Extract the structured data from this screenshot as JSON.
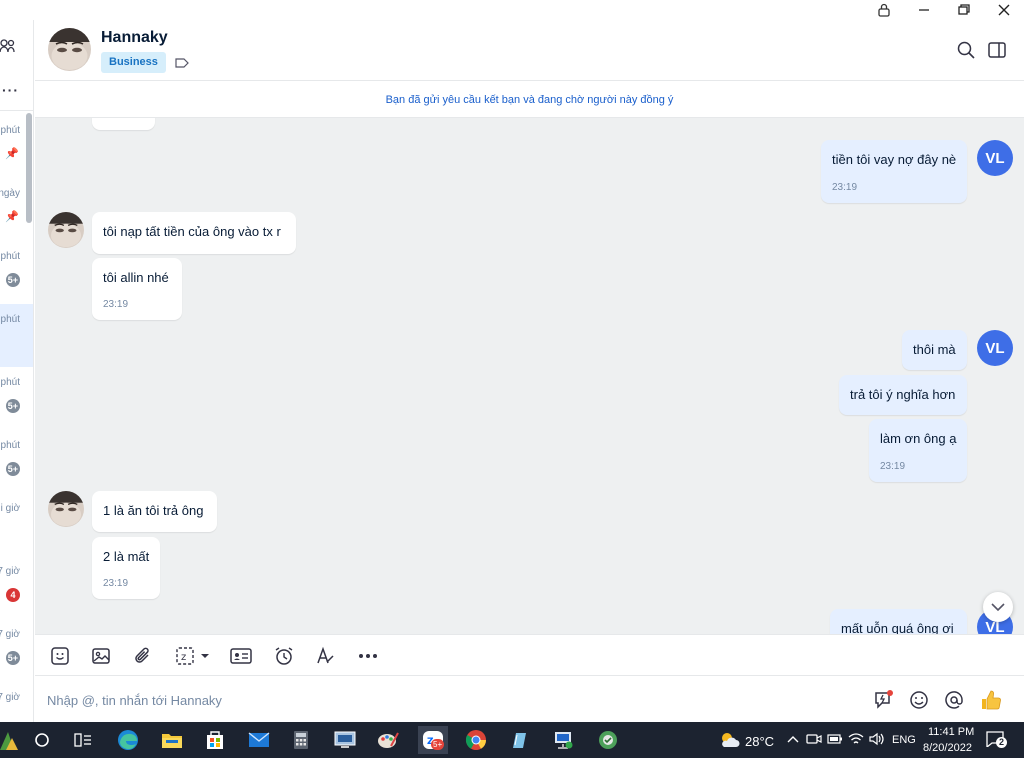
{
  "colors": {
    "accent": "#3e6ee7",
    "outgoing_bubble": "#e5efff",
    "incoming_bubble": "#ffffff",
    "chat_background": "#eef0f1",
    "business_badge": "#d6eefb"
  },
  "sidebar": {
    "items": [
      {
        "time": "phút",
        "badge": "",
        "pinned": true
      },
      {
        "time": "ngày",
        "badge": "",
        "pinned": true
      },
      {
        "time": "phút",
        "badge": "5+",
        "pinned": false
      },
      {
        "time": "phút",
        "badge": "",
        "pinned": false
      },
      {
        "time": "phút",
        "badge": "5+",
        "pinned": false
      },
      {
        "time": "phút",
        "badge": "5+",
        "pinned": false
      },
      {
        "time": "i giờ",
        "badge": "",
        "pinned": false
      },
      {
        "time": "7 giờ",
        "badge": "4",
        "pinned": false
      },
      {
        "time": "7 giờ",
        "badge": "5+",
        "pinned": false
      },
      {
        "time": "7 giờ",
        "badge": "",
        "pinned": false
      }
    ]
  },
  "header": {
    "name": "Hannaky",
    "badge": "Business"
  },
  "notice": "Bạn đã gửi yêu cầu kết bạn và đang chờ người này đồng ý",
  "messages": {
    "outgoing_avatar": "VL",
    "out1": {
      "text": "tiền tôi vay nợ đây nè",
      "time": "23:19"
    },
    "in1": {
      "text": "tôi nạp tất tiền của ông vào tx r"
    },
    "in2": {
      "text": "tôi allin nhé",
      "time": "23:19"
    },
    "out2": {
      "text": "thôi mà"
    },
    "out3": {
      "text": "trả tôi ý nghĩa hơn"
    },
    "out4": {
      "text": "làm ơn ông ạ",
      "time": "23:19"
    },
    "in3": {
      "text": "1 là ăn tôi trả ông"
    },
    "in4": {
      "text": "2 là mất",
      "time": "23:19"
    },
    "out5": {
      "text": "mất uỗn quá ông ơi"
    }
  },
  "composer": {
    "placeholder": "Nhập @, tin nhắn tới Hannaky"
  },
  "taskbar": {
    "zalo_badge": "5+",
    "weather": "28°C",
    "language": "ENG",
    "time": "11:41 PM",
    "date": "8/20/2022",
    "notifications": "2"
  }
}
